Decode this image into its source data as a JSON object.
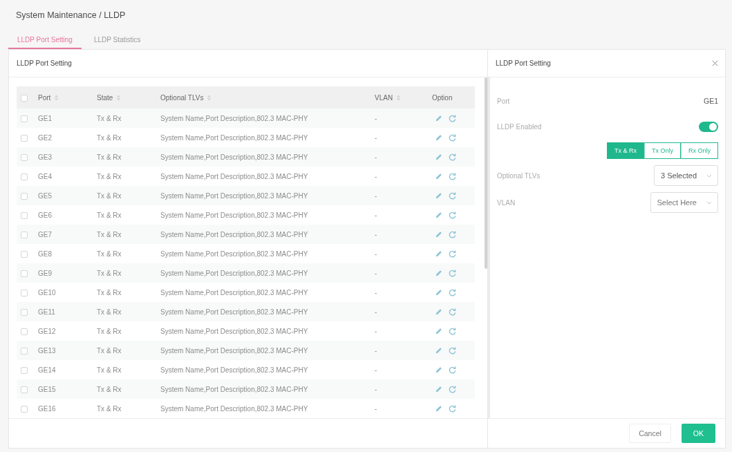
{
  "breadcrumb": "System Maintenance / LLDP",
  "tabs": [
    {
      "label": "LLDP Port Setting",
      "selected": true
    },
    {
      "label": "LLDP Statistics",
      "selected": false
    }
  ],
  "port_table": {
    "title": "LLDP Port Setting",
    "select_all": {
      "checked": false
    },
    "columns": [
      {
        "label": "Port",
        "sortable": true
      },
      {
        "label": "State",
        "sortable": true
      },
      {
        "label": "Optional TLVs",
        "sortable": true
      },
      {
        "label": "VLAN",
        "sortable": true
      },
      {
        "label": "Option",
        "sortable": false
      }
    ],
    "rows": [
      {
        "checked": false,
        "port": "GE1",
        "state": "Tx & Rx",
        "optional_tlvs": "System Name,Port Description,802.3 MAC-PHY",
        "vlan": "-"
      },
      {
        "checked": false,
        "port": "GE2",
        "state": "Tx & Rx",
        "optional_tlvs": "System Name,Port Description,802.3 MAC-PHY",
        "vlan": "-"
      },
      {
        "checked": false,
        "port": "GE3",
        "state": "Tx & Rx",
        "optional_tlvs": "System Name,Port Description,802.3 MAC-PHY",
        "vlan": "-"
      },
      {
        "checked": false,
        "port": "GE4",
        "state": "Tx & Rx",
        "optional_tlvs": "System Name,Port Description,802.3 MAC-PHY",
        "vlan": "-"
      },
      {
        "checked": false,
        "port": "GE5",
        "state": "Tx & Rx",
        "optional_tlvs": "System Name,Port Description,802.3 MAC-PHY",
        "vlan": "-"
      },
      {
        "checked": false,
        "port": "GE6",
        "state": "Tx & Rx",
        "optional_tlvs": "System Name,Port Description,802.3 MAC-PHY",
        "vlan": "-"
      },
      {
        "checked": false,
        "port": "GE7",
        "state": "Tx & Rx",
        "optional_tlvs": "System Name,Port Description,802.3 MAC-PHY",
        "vlan": "-"
      },
      {
        "checked": false,
        "port": "GE8",
        "state": "Tx & Rx",
        "optional_tlvs": "System Name,Port Description,802.3 MAC-PHY",
        "vlan": "-"
      },
      {
        "checked": false,
        "port": "GE9",
        "state": "Tx & Rx",
        "optional_tlvs": "System Name,Port Description,802.3 MAC-PHY",
        "vlan": "-"
      },
      {
        "checked": false,
        "port": "GE10",
        "state": "Tx & Rx",
        "optional_tlvs": "System Name,Port Description,802.3 MAC-PHY",
        "vlan": "-"
      },
      {
        "checked": false,
        "port": "GE11",
        "state": "Tx & Rx",
        "optional_tlvs": "System Name,Port Description,802.3 MAC-PHY",
        "vlan": "-"
      },
      {
        "checked": false,
        "port": "GE12",
        "state": "Tx & Rx",
        "optional_tlvs": "System Name,Port Description,802.3 MAC-PHY",
        "vlan": "-"
      },
      {
        "checked": false,
        "port": "GE13",
        "state": "Tx & Rx",
        "optional_tlvs": "System Name,Port Description,802.3 MAC-PHY",
        "vlan": "-"
      },
      {
        "checked": false,
        "port": "GE14",
        "state": "Tx & Rx",
        "optional_tlvs": "System Name,Port Description,802.3 MAC-PHY",
        "vlan": "-"
      },
      {
        "checked": false,
        "port": "GE15",
        "state": "Tx & Rx",
        "optional_tlvs": "System Name,Port Description,802.3 MAC-PHY",
        "vlan": "-"
      },
      {
        "checked": false,
        "port": "GE16",
        "state": "Tx & Rx",
        "optional_tlvs": "System Name,Port Description,802.3 MAC-PHY",
        "vlan": "-"
      }
    ]
  },
  "settings_panel": {
    "title": "LLDP Port Setting",
    "fields": [
      {
        "kind": "text",
        "label": "Port",
        "value": "GE1"
      },
      {
        "kind": "toggle",
        "label": "LLDP Enabled",
        "on": true
      },
      {
        "kind": "segmented",
        "options": [
          {
            "label": "Tx & Rx",
            "selected": true
          },
          {
            "label": "Tx Only",
            "selected": false
          },
          {
            "label": "Rx Only",
            "selected": false
          }
        ]
      },
      {
        "kind": "select",
        "label": "Optional TLVs",
        "value": "3 Selected"
      },
      {
        "kind": "select",
        "label": "VLAN",
        "placeholder": "Select Here"
      }
    ],
    "buttons": [
      {
        "label": "Cancel",
        "kind": "secondary"
      },
      {
        "label": "OK",
        "kind": "primary"
      }
    ]
  }
}
